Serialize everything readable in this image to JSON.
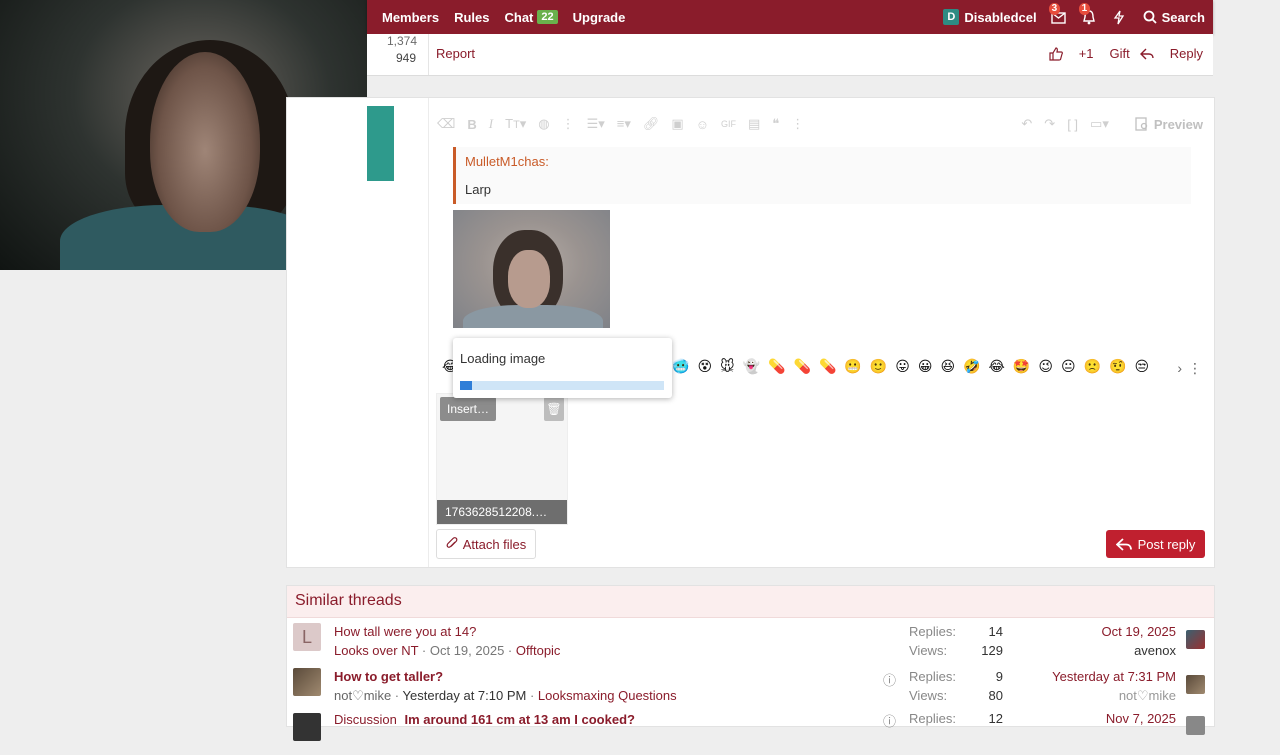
{
  "nav": {
    "items": [
      {
        "label": "Members"
      },
      {
        "label": "Rules"
      },
      {
        "label": "Chat"
      },
      {
        "label": "Upgrade"
      }
    ],
    "chat_badge": "22",
    "user_initial": "D",
    "username": "Disabledcel",
    "inbox_badge": "3",
    "alerts_badge": "1",
    "search_label": "Search",
    "color": "#8a1c2b"
  },
  "post_top": {
    "stat1": "1,374",
    "stat2": "949",
    "report_label": "Report",
    "like_label": "+1",
    "gift_label": "Gift",
    "reply_label": "Reply"
  },
  "editor": {
    "preview_label": "Preview",
    "quote_author": "MulletM1chas:",
    "quote_text": "Larp",
    "loading_text": "Loading image",
    "loading_progress": 0.06,
    "insert_label": "Insert…",
    "filename": "1763628512208.…",
    "attach_label": "Attach files",
    "post_reply_label": "Post reply",
    "emoji_prefix": "😂",
    "emojis": [
      "🥶",
      "😵",
      "🐭",
      "👻",
      "💊",
      "💊",
      "💊",
      "😬",
      "🙂",
      "😛",
      "😀",
      "😆",
      "🤣",
      "😂",
      "🤩",
      "😉",
      "😐",
      "🙁",
      "🤨",
      "😒"
    ]
  },
  "similar": {
    "title": "Similar threads",
    "replies_label": "Replies:",
    "views_label": "Views:",
    "threads": [
      {
        "avatar_letter": "L",
        "title": "How tall were you at 14?",
        "author": "Looks over NT",
        "date": "Oct 19, 2025",
        "forum": "Offtopic",
        "replies": "14",
        "views": "129",
        "last_date": "Oct 19, 2025",
        "last_user": "avenox",
        "question": false
      },
      {
        "avatar_letter": "",
        "title": "How to get taller?",
        "author": "not♡mike",
        "date": "Yesterday at 7:10 PM",
        "forum": "Looksmaxing Questions",
        "replies": "9",
        "views": "80",
        "last_date": "Yesterday at 7:31 PM",
        "last_user": "not♡mike",
        "question": true
      },
      {
        "avatar_letter": "",
        "prefix": "Discussion",
        "title": "Im around 161 cm at 13 am I cooked?",
        "author": "",
        "date": "",
        "forum": "",
        "replies": "12",
        "views": "",
        "last_date": "Nov 7, 2025",
        "last_user": "",
        "question": true
      }
    ]
  }
}
